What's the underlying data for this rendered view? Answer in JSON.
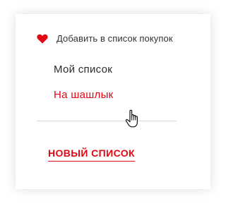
{
  "menu": {
    "header": {
      "icon": "heart-icon",
      "label": "Добавить в список покупок"
    },
    "lists": [
      {
        "label": "Мой список",
        "state": "default"
      },
      {
        "label": "На шашлык",
        "state": "hover"
      }
    ],
    "new_list_label": "НОВЫЙ СПИСОК"
  },
  "cursor": {
    "icon": "hand-pointer-icon"
  },
  "colors": {
    "accent": "#e30613",
    "text": "#2b2b2b",
    "divider": "#d9d9d9"
  }
}
